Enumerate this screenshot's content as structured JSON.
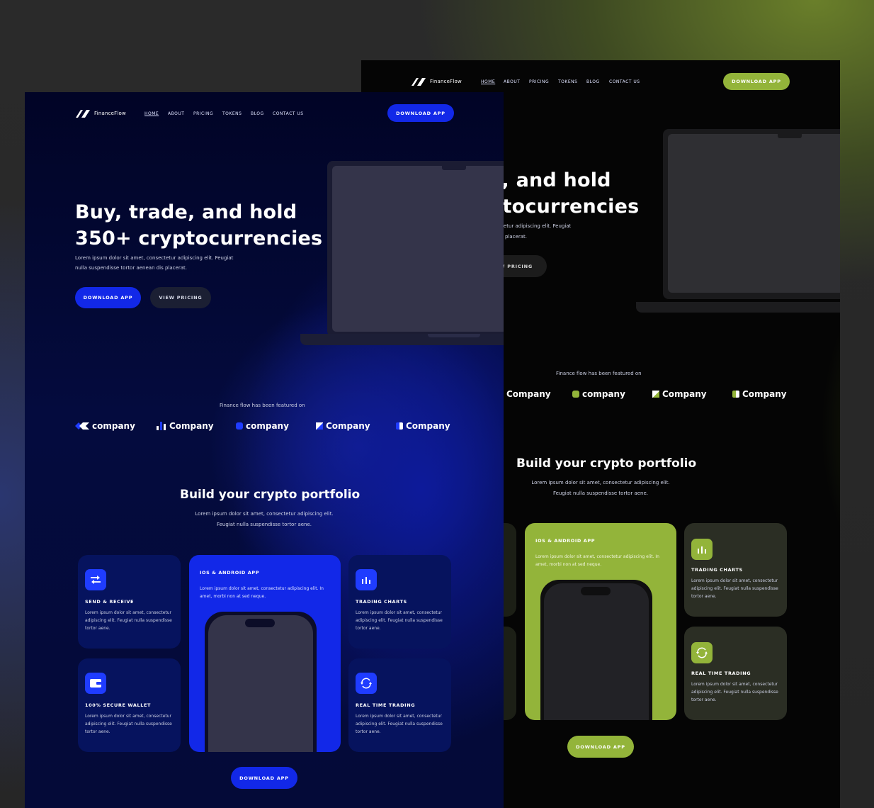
{
  "brand": "FinanceFlow",
  "nav": [
    "HOME",
    "ABOUT",
    "PRICING",
    "TOKENS",
    "BLOG",
    "CONTACT US"
  ],
  "download_label": "DOWNLOAD APP",
  "view_pricing_label": "VIEW PRICING",
  "hero": {
    "line1": "Buy, trade, and hold",
    "line2": "350+ cryptocurrencies",
    "sub1": "Lorem ipsum dolor sit amet, consectetur adipiscing elit. Feugiat",
    "sub2": "nulla suspendisse tortor aenean dis placerat.",
    "green_line1": "e, and hold",
    "green_line2": "ptocurrencies",
    "green_sub1": "ectetur adipiscing elit. Feugiat",
    "green_sub2": "placerat.",
    "green_pricing": "EW PRICING"
  },
  "featured": {
    "blue_label": "Finance flow has been featured on",
    "green_label": "Finance flow has been featured on",
    "blue_companies": [
      "company",
      "Company",
      "company",
      "Company",
      "Company"
    ],
    "green_companies": [
      "Company",
      "company",
      "Company",
      "Company"
    ]
  },
  "section": {
    "title": "Build your crypto portfolio",
    "sub1": "Lorem ipsum dolor sit amet, consectetur adipiscing elit.",
    "sub2": "Feugiat nulla suspendisse tortor aene."
  },
  "cards": {
    "send": {
      "title": "SEND & RECEIVE",
      "desc": "Lorem ipsum dolor sit amet, consectetur adipiscing elit. Feugiat nulla suspendisse tortor aene."
    },
    "wallet": {
      "title": "100% SECURE WALLET",
      "desc": "Lorem ipsum dolor sit amet, consectetur adipiscing elit. Feugiat nulla suspendisse tortor aene."
    },
    "app": {
      "title": "IOS & ANDROID APP",
      "desc": "Lorem ipsum dolor sit amet, consectetur adipiscing elit. In amet, morbi non at sed neque."
    },
    "charts": {
      "title": "TRADING CHARTS",
      "desc": "Lorem ipsum dolor sit amet, consectetur adipiscing elit. Feugiat nulla suspendisse tortor aene."
    },
    "realtime": {
      "title": "REAL TIME TRADING",
      "desc": "Lorem ipsum dolor sit amet, consectetur adipiscing elit. Feugiat nulla suspendisse tortor aene."
    }
  },
  "colors": {
    "blue_accent": "#1228e8",
    "green_accent": "#93b43a"
  },
  "icons": [
    "swap-arrows-icon",
    "wallet-icon",
    "bar-chart-icon",
    "refresh-icon",
    "company-logo-icon"
  ]
}
